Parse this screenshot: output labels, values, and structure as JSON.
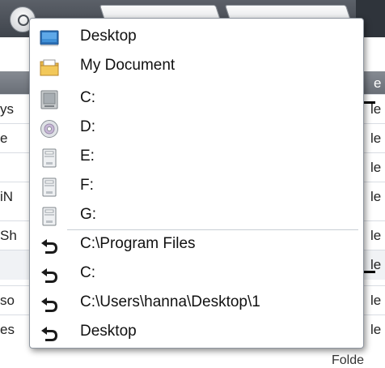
{
  "dropdown": {
    "locations": [
      {
        "label": "Desktop",
        "icon": "desktop-icon"
      },
      {
        "label": "My Document",
        "icon": "documents-folder-icon"
      },
      {
        "label": "C:",
        "icon": "hard-drive-icon"
      },
      {
        "label": "D:",
        "icon": "cd-drive-icon"
      },
      {
        "label": "E:",
        "icon": "removable-drive-icon"
      },
      {
        "label": "F:",
        "icon": "removable-drive-icon"
      },
      {
        "label": "G:",
        "icon": "removable-drive-icon"
      }
    ],
    "history": [
      {
        "label": "C:\\Program Files",
        "icon": "history-back-icon"
      },
      {
        "label": "C:",
        "icon": "history-back-icon"
      },
      {
        "label": "C:\\Users\\hanna\\Desktop\\1",
        "icon": "history-back-icon"
      },
      {
        "label": "Desktop",
        "icon": "history-back-icon"
      }
    ]
  },
  "background": {
    "header_fragment": "e",
    "rows": [
      {
        "left": "ys",
        "right": "le"
      },
      {
        "left": "e",
        "right": "le"
      },
      {
        "left": "",
        "right": "le"
      },
      {
        "left": "iN",
        "right": "le"
      },
      {
        "left": "Sh",
        "right": "le"
      },
      {
        "left": "",
        "right": "le"
      },
      {
        "left": "so",
        "right": "le"
      },
      {
        "left": "es",
        "right": "le"
      }
    ],
    "bottom_fragment": "Folde"
  },
  "colors": {
    "toolbar": "#4a4f57",
    "popup_border": "#8f96a0",
    "history_arrow": "#1a1a1a"
  }
}
